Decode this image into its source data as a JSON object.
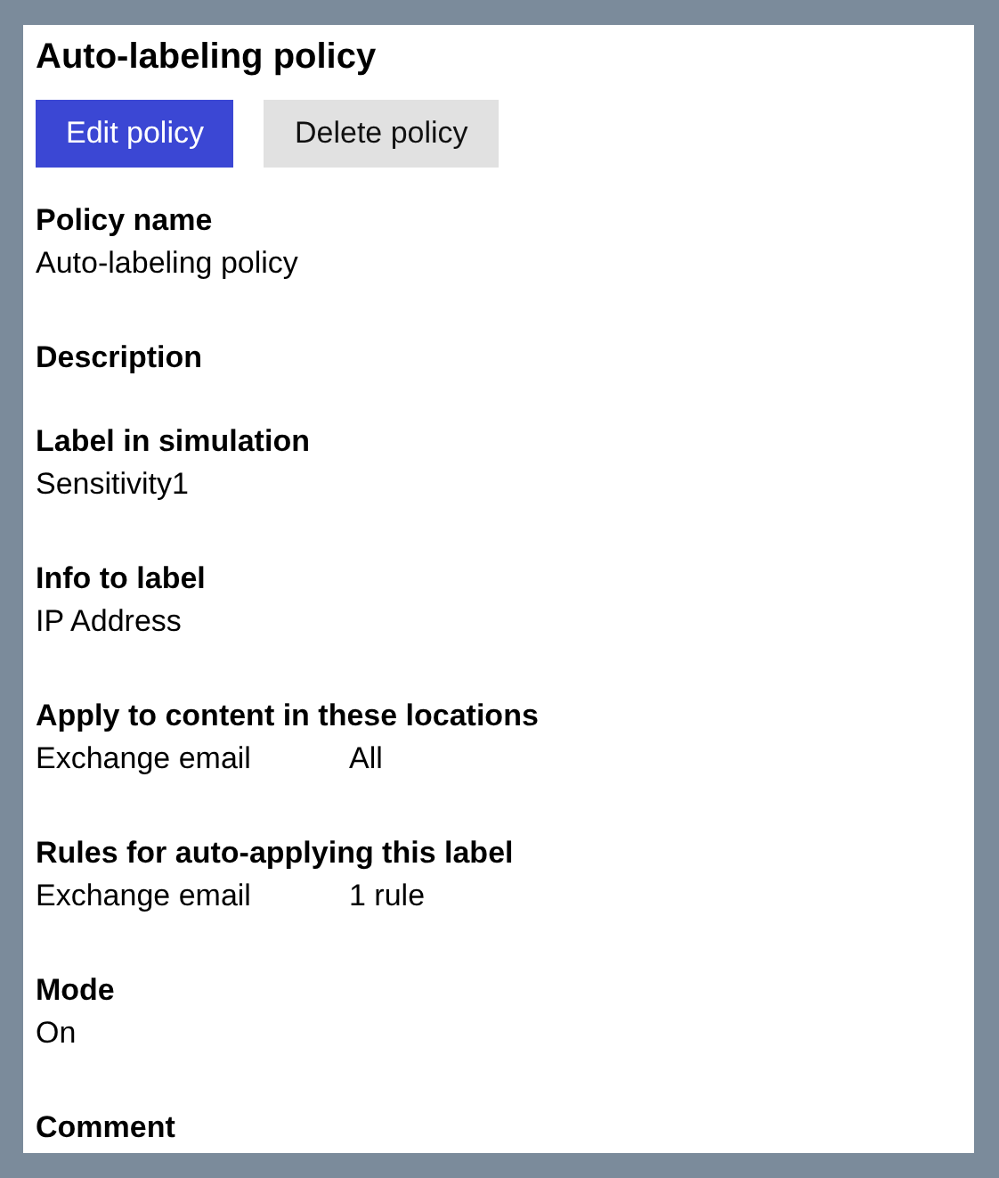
{
  "title": "Auto-labeling policy",
  "buttons": [
    {
      "label": "Edit policy",
      "kind": "primary"
    },
    {
      "label": "Delete policy",
      "kind": "secondary"
    }
  ],
  "sections": [
    {
      "label": "Policy name",
      "values": [
        "Auto-labeling policy"
      ]
    },
    {
      "label": "Description"
    },
    {
      "label": "Label in simulation",
      "values": [
        "Sensitivity1"
      ]
    },
    {
      "label": "Info to label",
      "values": [
        "IP Address"
      ]
    },
    {
      "label": "Apply to content in these locations",
      "values": [
        "Exchange email",
        "All"
      ]
    },
    {
      "label": "Rules for auto-applying this label",
      "values": [
        "Exchange email",
        "1 rule"
      ]
    },
    {
      "label": "Mode",
      "values": [
        "On"
      ]
    },
    {
      "label": "Comment"
    }
  ]
}
